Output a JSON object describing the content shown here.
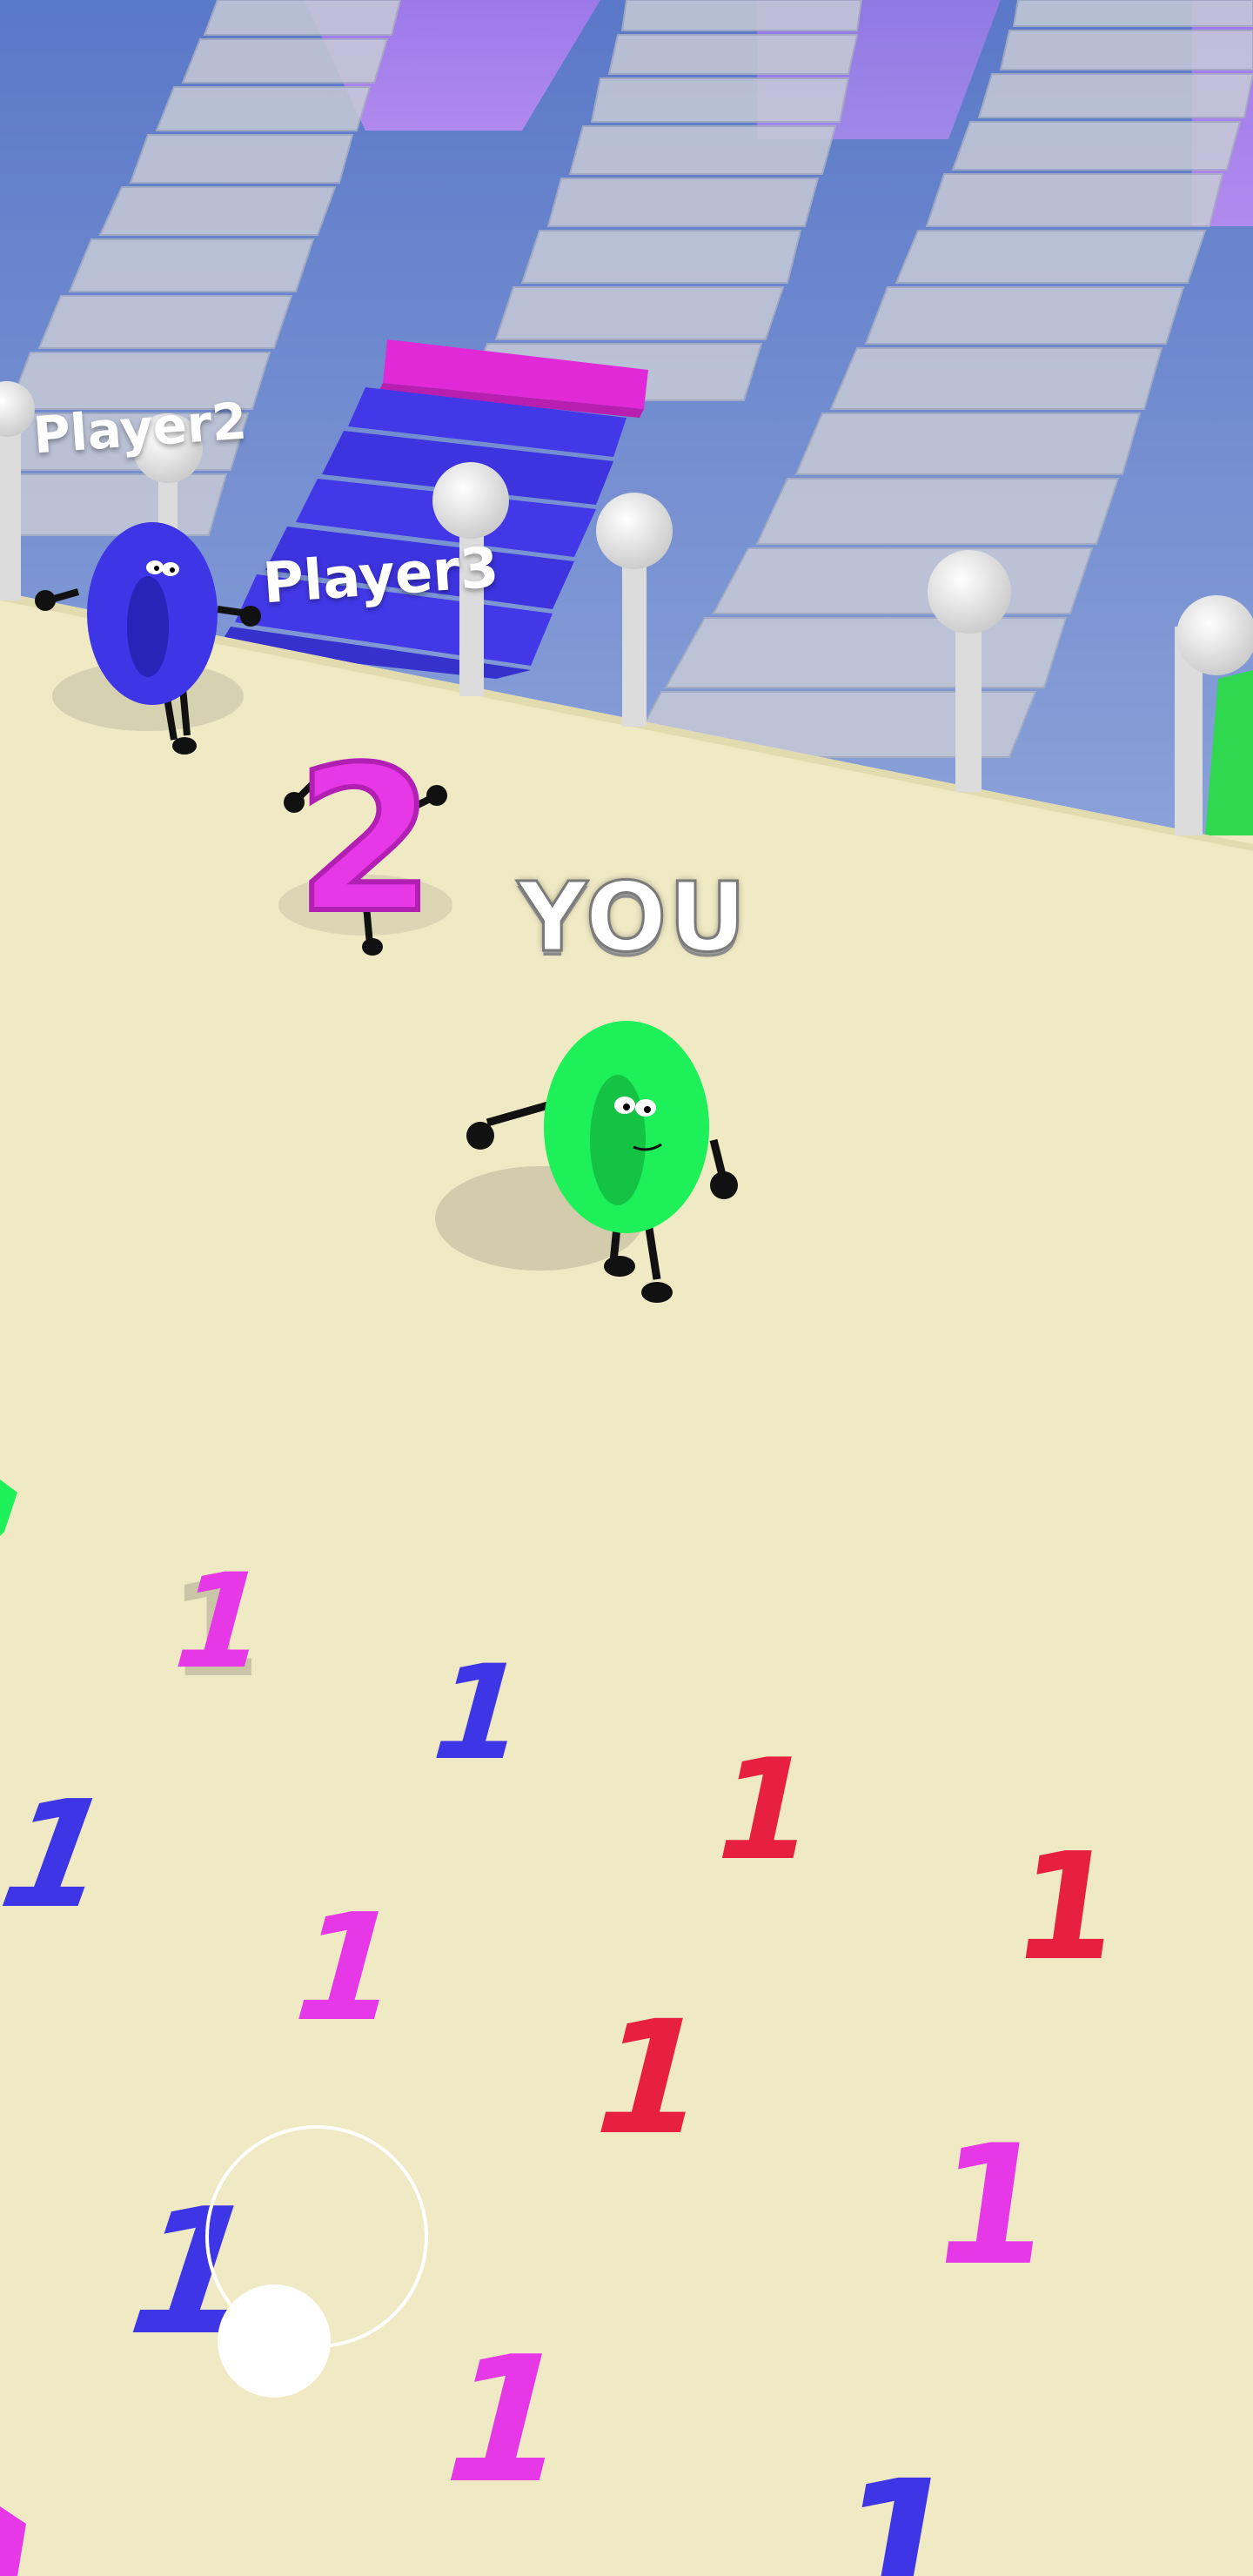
{
  "players": [
    {
      "name": "Player2",
      "number": "0",
      "color": "#3d35e6"
    },
    {
      "name": "Player3",
      "number": "2",
      "color": "#e638e6"
    },
    {
      "name": "YOU",
      "number": "0",
      "color": "#1ef05a"
    }
  ],
  "hud": {
    "you_label": "YOU",
    "player2_label": "Player2",
    "player3_label": "Player3"
  },
  "colors": {
    "ground": "#efe9c4",
    "water": "#6f8bd0",
    "stairs": "#c9cdd8",
    "blue": "#3d35e6",
    "magenta": "#e638e6",
    "red": "#e8203f",
    "green": "#1ef05a",
    "joystick": "#ffffff"
  },
  "pickups": [
    {
      "digit": "1",
      "color": "magenta"
    },
    {
      "digit": "1",
      "color": "blue"
    },
    {
      "digit": "1",
      "color": "red"
    },
    {
      "digit": "1",
      "color": "red"
    },
    {
      "digit": "1",
      "color": "blue"
    },
    {
      "digit": "1",
      "color": "magenta"
    },
    {
      "digit": "1",
      "color": "red"
    },
    {
      "digit": "1",
      "color": "magenta"
    },
    {
      "digit": "1",
      "color": "blue"
    },
    {
      "digit": "1",
      "color": "magenta"
    },
    {
      "digit": "1",
      "color": "blue"
    }
  ],
  "controls": {
    "joystick": "virtual-joystick"
  }
}
